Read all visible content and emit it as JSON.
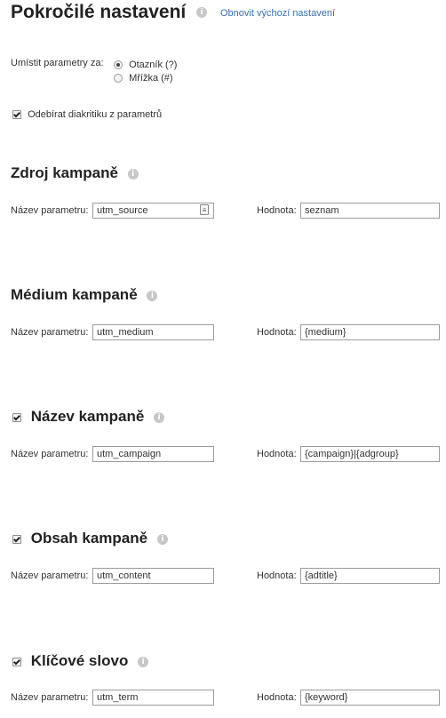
{
  "header": {
    "title": "Pokročilé nastavení",
    "info_icon": "info-icon",
    "reset_link": "Obnovit výchozí nastavení"
  },
  "placement": {
    "label": "Umístit parametry za:",
    "options": [
      {
        "label": "Otazník (?)",
        "selected": true
      },
      {
        "label": "Mřížka (#)",
        "selected": false
      }
    ]
  },
  "strip_diacritics": {
    "label": "Odebírat diakritiku z parametrů",
    "checked": true
  },
  "common": {
    "param_label": "Název parametru:",
    "value_label": "Hodnota:",
    "info_glyph": "i"
  },
  "sections": [
    {
      "title": "Zdroj kampaně",
      "param": "utm_source",
      "value": "seznam",
      "has_checkbox": false
    },
    {
      "title": "Médium kampaně",
      "param": "utm_medium",
      "value": "{medium}",
      "has_checkbox": false
    },
    {
      "title": "Název kampaně",
      "param": "utm_campaign",
      "value": "{campaign}|{adgroup}",
      "has_checkbox": true,
      "checked": true
    },
    {
      "title": "Obsah kampaně",
      "param": "utm_content",
      "value": "{adtitle}",
      "has_checkbox": true,
      "checked": true
    },
    {
      "title": "Klíčové slovo",
      "param": "utm_term",
      "value": "{keyword}",
      "has_checkbox": true,
      "checked": true
    }
  ],
  "colors": {
    "link": "#3a6fb0",
    "info_icon": "#c7c7c7",
    "text": "#333333"
  }
}
